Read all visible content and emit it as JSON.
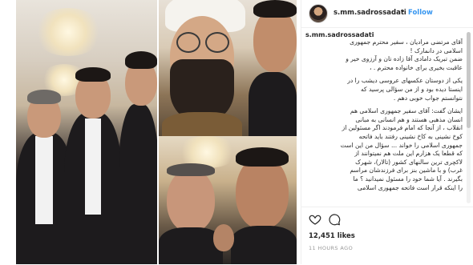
{
  "post": {
    "username": "s.mm.sadrossadati",
    "follow_label": "Follow",
    "dot": "•",
    "caption_user": "s.mm.sadrossadati",
    "caption_lines": [
      "آقای مرتضی مرادیان ، سفیر محترم جمهوری",
      "اسلامی در دانمارک !",
      "ضمن تبریک دامادی آقا زاده تان و آرزوی خیر و",
      "عاقبت بخیری برای خانواده محترم . ،",
      "",
      "یکی از دوستان عکسهای عروسی دیشب را در",
      "اینستا دیده بود و از من سؤالی پرسید که",
      "نتوانستم جواب خوبی دهم .",
      "",
      "ایشان گفت: آقای سفیر جمهوری اسلامی هم",
      "انسان مذهبی هستند و هم انسانی به مبانی",
      "انقلاب ، از آنجا که امام فرمودند اگر مسئولین از",
      "کوخ نشینی به کاخ نشینی رفتند باید فاتحه",
      "جمهوری اسلامی را خواند ... سؤال من این است",
      "که قطعا یک هزارم این ملت هم نمیتوانند از",
      "لاکچری ترین سالنهای کشور (تالار)، شهرک",
      "غرب) و با ماشین بنز برای فرزندشان مراسم",
      "بگیرند . آیا شما خود را مسئول نمیدانید ؟ ما",
      "را اینکه قرار است فاتحه جمهوری اسلامی"
    ],
    "likes": "12,451 likes",
    "time": "11 HOURS AGO"
  },
  "icons": {
    "heart": "heart-icon",
    "comment": "comment-icon"
  }
}
